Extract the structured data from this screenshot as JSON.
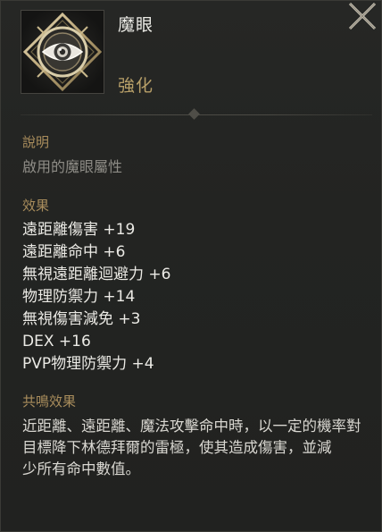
{
  "item": {
    "name": "魔眼",
    "type": "強化",
    "icon": "eye-emblem-icon"
  },
  "close_icon": "close-x-icon",
  "description": {
    "title": "說明",
    "text": "啟用的魔眼屬性"
  },
  "effects": {
    "title": "效果",
    "rows": [
      "遠距離傷害 +19",
      "遠距離命中 +6",
      "無視遠距離迴避力 +6",
      "物理防禦力 +14",
      "無視傷害減免 +3",
      "DEX +16",
      "PVP物理防禦力 +4"
    ]
  },
  "resonance": {
    "title": "共鳴效果",
    "lines": [
      "近距離、遠距離、魔法攻擊命中時，以一定的機率對",
      "目標降下林德拜爾的雷極，使其造成傷害，並減",
      "少所有命中數值。"
    ]
  },
  "colors": {
    "background": "#232422",
    "section_title": "#a98d5c",
    "item_type": "#b79f68",
    "text": "#ebeae5",
    "muted_text": "#8e8c86"
  }
}
